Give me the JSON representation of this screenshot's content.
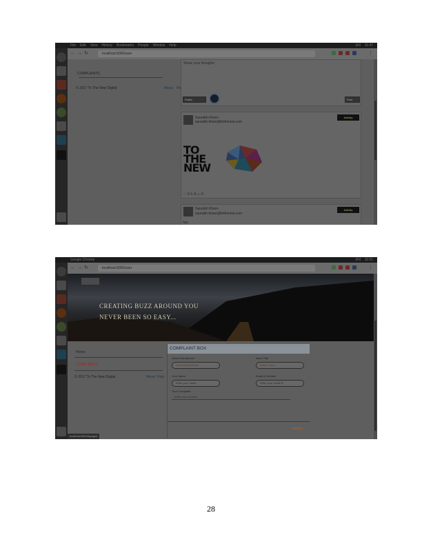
{
  "page_number": "28",
  "colors": {
    "dimmed_overlay": "#5a5a5a",
    "post_button_text": "#bdbd55",
    "submit_text": "#c0601a",
    "complaints_red": "#9a2a1a"
  },
  "screenshot1": {
    "address_bar": "localhost:5000/user",
    "sidebar": {
      "section_title": "COMPLAINTS",
      "items": [
        {
          "text": "2017 To The New Digital",
          "about": "About",
          "help": "Help"
        }
      ]
    },
    "composer": {
      "placeholder": "Share your thoughts",
      "visibility_select": "Public",
      "post_button": "Post"
    },
    "posts": [
      {
        "author": "Saurabh Khare",
        "email": "saurabh.khare@tothenew.com",
        "action_button": "Activity",
        "image_text": [
          "TO",
          "THE",
          "NEW"
        ],
        "stats": [
          "0",
          "0",
          "0"
        ]
      },
      {
        "author": "Saurabh Khare",
        "email": "saurabh.khare@tothenew.com",
        "action_button": "Activity",
        "body": "hey"
      }
    ]
  },
  "screenshot2": {
    "window_title": "Google Chrome",
    "address_bar": "localhost:5000/user",
    "hero": {
      "line1": "CREATING BUZZ AROUND YOU",
      "line2": "NEVER BEEN SO EASY..."
    },
    "sidebar": {
      "home": "Home",
      "section_title": "COMPLAINTS",
      "items": [
        {
          "text": "2017 To The New Digital",
          "about": "About",
          "help": "Help"
        }
      ]
    },
    "complaint_box": {
      "title": "COMPLAINT BOX",
      "fields": {
        "select_department": {
          "label": "Select Department",
          "value": "Select Department"
        },
        "issue_title": {
          "label": "Issue Title",
          "value": "Select Issue"
        },
        "your_name": {
          "label": "Your Name",
          "placeholder": "Enter your name"
        },
        "email": {
          "label": "Email Id Verified",
          "placeholder": "Enter your email ID"
        },
        "complaint": {
          "label": "Your Complaint",
          "placeholder": "Write your concern"
        }
      },
      "submit": "SUBMIT"
    },
    "status_bar": "localhost:5000/#page#"
  }
}
